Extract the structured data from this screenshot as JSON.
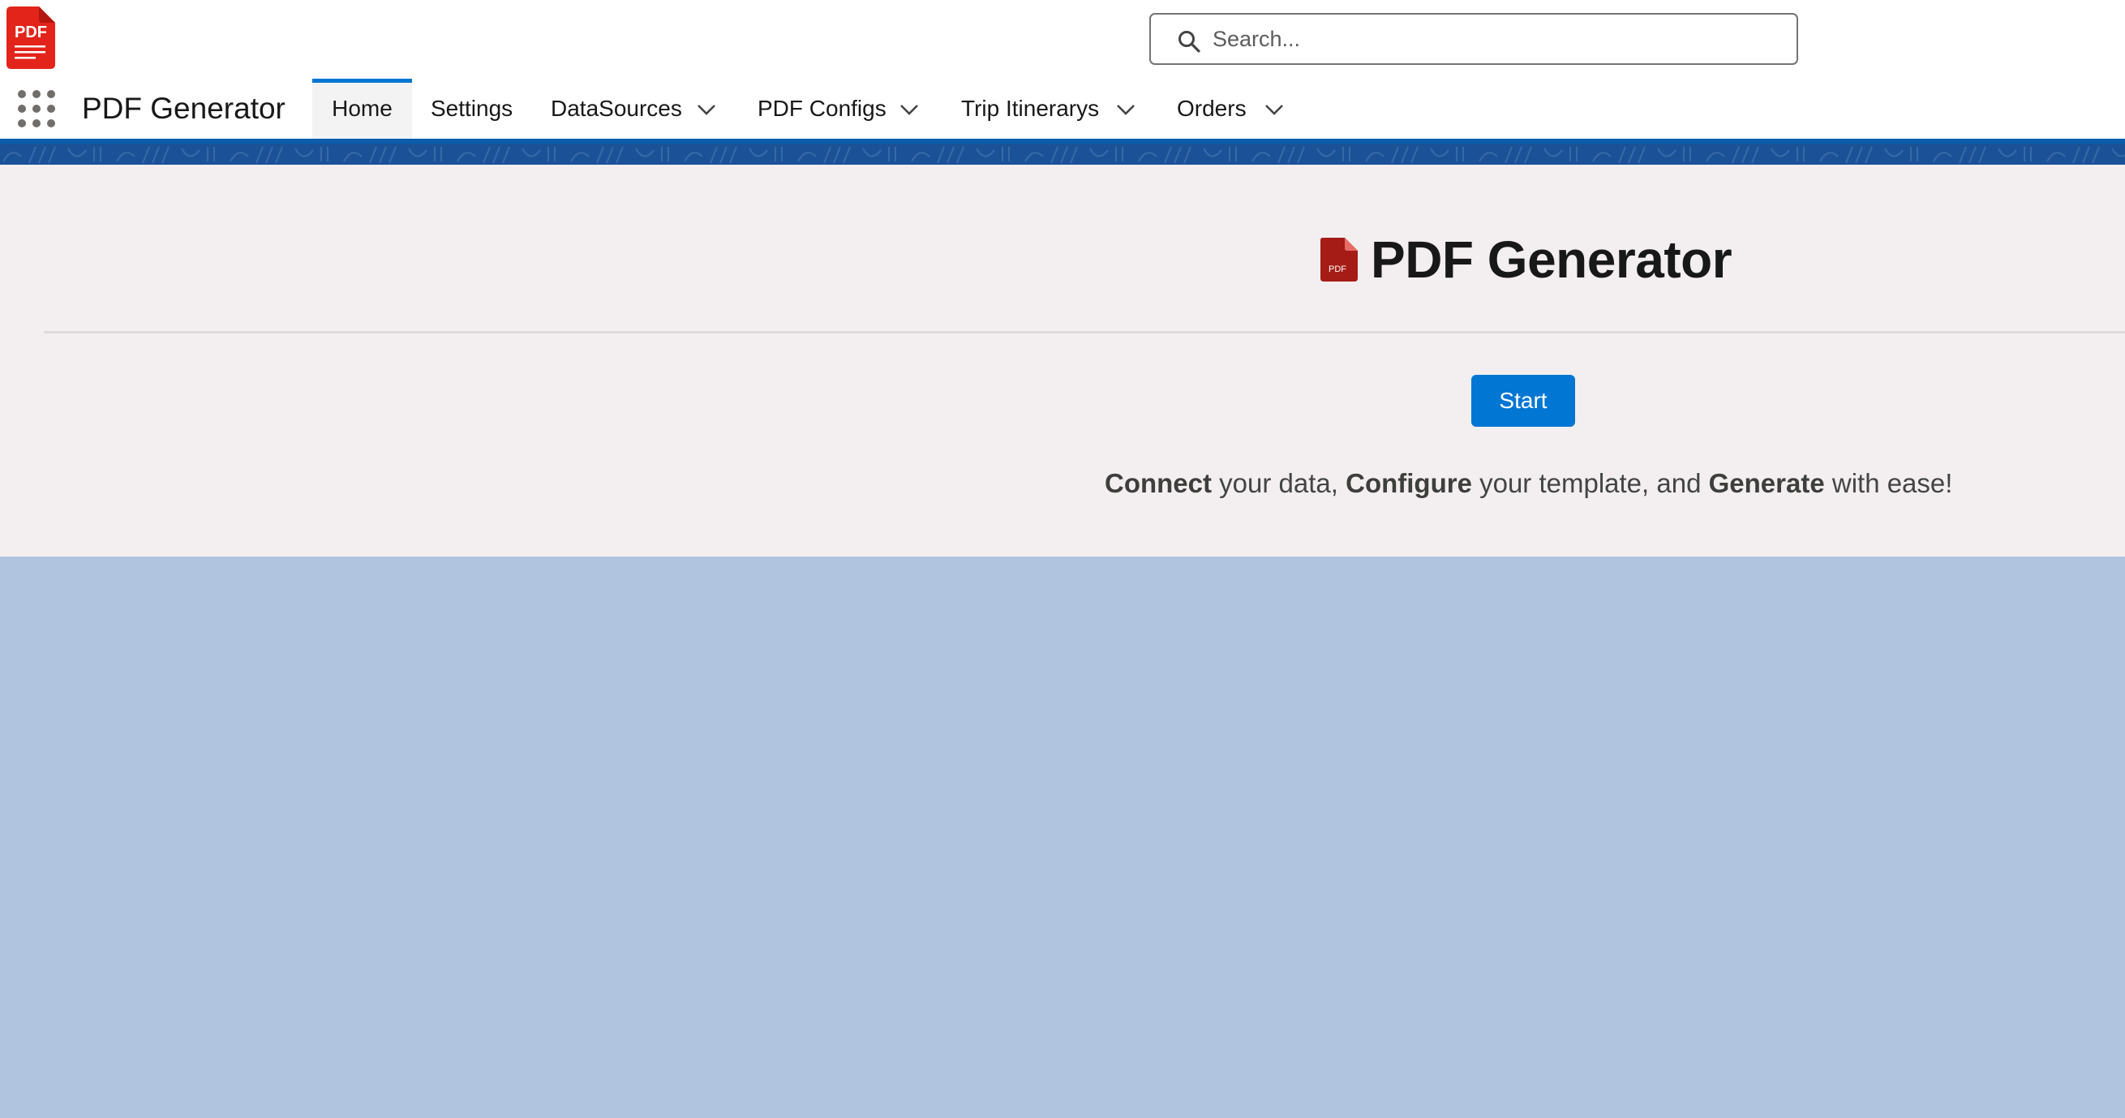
{
  "header": {
    "logo_text": "PDF",
    "search": {
      "placeholder": "Search..."
    }
  },
  "nav": {
    "app_name": "PDF Generator",
    "items": [
      {
        "label": "Home",
        "active": true,
        "has_menu": false
      },
      {
        "label": "Settings",
        "active": false,
        "has_menu": false
      },
      {
        "label": "DataSources",
        "active": false,
        "has_menu": true
      },
      {
        "label": "PDF Configs",
        "active": false,
        "has_menu": true
      },
      {
        "label": "Trip Itinerarys",
        "active": false,
        "has_menu": true
      },
      {
        "label": "Orders",
        "active": false,
        "has_menu": true
      }
    ]
  },
  "home": {
    "title": "PDF Generator",
    "title_icon_text": "PDF",
    "start_label": "Start",
    "tagline": {
      "w1": "Connect",
      "t1": " your data, ",
      "w2": "Configure",
      "t2": " your template, and ",
      "w3": "Generate",
      "t3": " with ease!"
    }
  },
  "colors": {
    "accent": "#0176d3",
    "brand_band": "#1b5297",
    "page_background": "#b0c4df",
    "panel_background": "#f3eff0",
    "pdf_red": "#e3241b"
  }
}
